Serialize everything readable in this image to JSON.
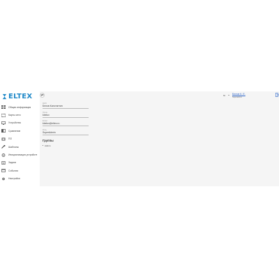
{
  "brand": {
    "name": "ELTEX",
    "color": "#1e88c8"
  },
  "sidebar": {
    "items": [
      {
        "label": "Общая информация",
        "icon": "dashboard-icon"
      },
      {
        "label": "Карты сети",
        "icon": "map-icon"
      },
      {
        "label": "Устройства",
        "icon": "devices-icon"
      },
      {
        "label": "Сравнение",
        "icon": "compare-icon"
      },
      {
        "label": "ПО",
        "icon": "software-icon"
      },
      {
        "label": "Шаблоны",
        "icon": "wrench-icon"
      },
      {
        "label": "Инициализация устройств",
        "icon": "init-icon"
      },
      {
        "label": "Задачи",
        "icon": "tasks-icon"
      },
      {
        "label": "События",
        "icon": "events-icon"
      },
      {
        "label": "Настройки",
        "icon": "settings-icon"
      }
    ]
  },
  "topbar": {
    "back_symbol": "⇄",
    "language": "ru",
    "user_name": "Белов К. Е.",
    "user_role": "Superadmin"
  },
  "profile": {
    "fields": [
      {
        "label": "ФИО",
        "value": "Белов Константин"
      },
      {
        "label": "Логин",
        "value": "kbelov"
      },
      {
        "label": "Email",
        "value": "kbelov@eltex.ru"
      },
      {
        "label": "Роль",
        "value": "SuperAdmin"
      }
    ],
    "groups_title": "Группы",
    "groups": [
      "Admin"
    ]
  },
  "colors": {
    "accent": "#1e88c8",
    "link": "#2a63c8",
    "main_bg": "#f5f5f5"
  }
}
